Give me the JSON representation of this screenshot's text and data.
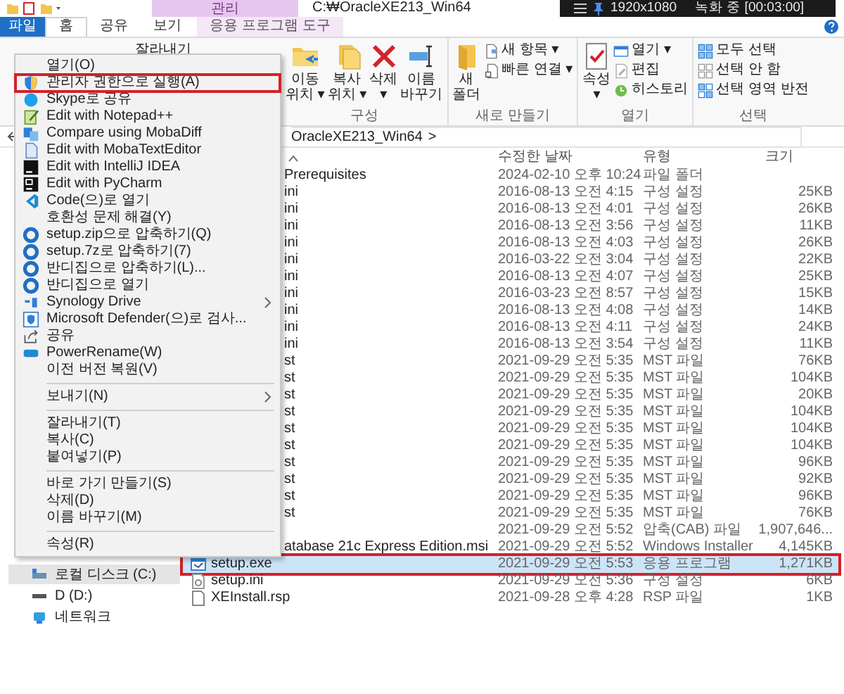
{
  "title_bar": {
    "context_label": "관리",
    "title": "C:₩OracleXE213_Win64"
  },
  "recorder": {
    "resolution": "1920x1080",
    "status": "녹화 중 [00:03:00]"
  },
  "tabs": [
    {
      "label": "파일",
      "kind": "file",
      "selected": false
    },
    {
      "label": "홈",
      "kind": "plain",
      "selected": true
    },
    {
      "label": "공유",
      "kind": "plain",
      "selected": false
    },
    {
      "label": "보기",
      "kind": "plain",
      "selected": false
    },
    {
      "label": "응용 프로그램 도구",
      "kind": "context",
      "selected": false
    }
  ],
  "ribbon": {
    "clipboard_fragment": "잘라내기",
    "groups": [
      {
        "label": "구성",
        "buttons": [
          {
            "kind": "move",
            "lines": [
              "이동",
              "위치 ▾"
            ]
          },
          {
            "kind": "copy",
            "lines": [
              "복사",
              "위치 ▾"
            ]
          },
          {
            "kind": "delete",
            "lines": [
              "삭제",
              "▾"
            ]
          },
          {
            "kind": "rename",
            "lines": [
              "이름",
              "바꾸기"
            ]
          }
        ]
      },
      {
        "label": "새로 만들기",
        "buttons": [
          {
            "kind": "new-folder",
            "lines": [
              "새",
              "폴더"
            ]
          },
          {
            "kind": "new-item",
            "lines": [
              "새 항목 ▾"
            ]
          },
          {
            "kind": "quick-link",
            "lines": [
              "빠른 연결 ▾"
            ]
          }
        ]
      },
      {
        "label": "열기",
        "buttons": [
          {
            "kind": "properties",
            "lines": [
              "속성",
              "▾"
            ]
          },
          {
            "kind": "open",
            "lines": [
              "열기 ▾"
            ]
          },
          {
            "kind": "edit",
            "lines": [
              "편집"
            ]
          },
          {
            "kind": "history",
            "lines": [
              "히스토리"
            ]
          }
        ]
      },
      {
        "label": "선택",
        "buttons": [
          {
            "kind": "select-all",
            "lines": [
              "모두 선택"
            ]
          },
          {
            "kind": "select-none",
            "lines": [
              "선택 안 함"
            ]
          },
          {
            "kind": "invert",
            "lines": [
              "선택 영역 반전"
            ]
          }
        ]
      }
    ]
  },
  "address": {
    "path": "OracleXE213_Win64",
    "separator": ">"
  },
  "nav": [
    {
      "label": "로컬 디스크 (C:)",
      "kind": "drive",
      "selected": true
    },
    {
      "label": "D (D:)",
      "kind": "disk",
      "selected": false
    },
    {
      "label": "네트워크",
      "kind": "network",
      "selected": false
    }
  ],
  "columns": [
    "수정한 날짜",
    "유형",
    "크기"
  ],
  "rows": [
    {
      "kind": "fragment",
      "name": "Prerequisites",
      "date": "2024-02-10 오후 10:24",
      "type": "파일 폴더",
      "selected": false,
      "annotated": false
    },
    {
      "kind": "fragment",
      "name": "ini",
      "date": "2016-08-13 오전 4:15",
      "type": "구성 설정",
      "size": "25KB",
      "selected": false,
      "annotated": false
    },
    {
      "kind": "fragment",
      "name": "ini",
      "date": "2016-08-13 오전 4:01",
      "type": "구성 설정",
      "size": "26KB",
      "selected": false,
      "annotated": false
    },
    {
      "kind": "fragment",
      "name": "ini",
      "date": "2016-08-13 오전 3:56",
      "type": "구성 설정",
      "size": "11KB",
      "selected": false,
      "annotated": false
    },
    {
      "kind": "fragment",
      "name": "ini",
      "date": "2016-08-13 오전 4:03",
      "type": "구성 설정",
      "size": "26KB",
      "selected": false,
      "annotated": false
    },
    {
      "kind": "fragment",
      "name": "ini",
      "date": "2016-03-22 오전 3:04",
      "type": "구성 설정",
      "size": "22KB",
      "selected": false,
      "annotated": false
    },
    {
      "kind": "fragment",
      "name": "ini",
      "date": "2016-08-13 오전 4:07",
      "type": "구성 설정",
      "size": "25KB",
      "selected": false,
      "annotated": false
    },
    {
      "kind": "fragment",
      "name": "ini",
      "date": "2016-03-23 오전 8:57",
      "type": "구성 설정",
      "size": "15KB",
      "selected": false,
      "annotated": false
    },
    {
      "kind": "fragment",
      "name": "ini",
      "date": "2016-08-13 오전 4:08",
      "type": "구성 설정",
      "size": "14KB",
      "selected": false,
      "annotated": false
    },
    {
      "kind": "fragment",
      "name": "ini",
      "date": "2016-08-13 오전 4:11",
      "type": "구성 설정",
      "size": "24KB",
      "selected": false,
      "annotated": false
    },
    {
      "kind": "fragment",
      "name": "ini",
      "date": "2016-08-13 오전 3:54",
      "type": "구성 설정",
      "size": "11KB",
      "selected": false,
      "annotated": false
    },
    {
      "kind": "fragment",
      "name": "st",
      "date": "2021-09-29 오전 5:35",
      "type": "MST 파일",
      "size": "76KB",
      "selected": false,
      "annotated": false
    },
    {
      "kind": "fragment",
      "name": "st",
      "date": "2021-09-29 오전 5:35",
      "type": "MST 파일",
      "size": "104KB",
      "selected": false,
      "annotated": false
    },
    {
      "kind": "fragment",
      "name": "st",
      "date": "2021-09-29 오전 5:35",
      "type": "MST 파일",
      "size": "20KB",
      "selected": false,
      "annotated": false
    },
    {
      "kind": "fragment",
      "name": "st",
      "date": "2021-09-29 오전 5:35",
      "type": "MST 파일",
      "size": "104KB",
      "selected": false,
      "annotated": false
    },
    {
      "kind": "fragment",
      "name": "st",
      "date": "2021-09-29 오전 5:35",
      "type": "MST 파일",
      "size": "104KB",
      "selected": false,
      "annotated": false
    },
    {
      "kind": "fragment",
      "name": "st",
      "date": "2021-09-29 오전 5:35",
      "type": "MST 파일",
      "size": "104KB",
      "selected": false,
      "annotated": false
    },
    {
      "kind": "fragment",
      "name": "st",
      "date": "2021-09-29 오전 5:35",
      "type": "MST 파일",
      "size": "96KB",
      "selected": false,
      "annotated": false
    },
    {
      "kind": "fragment",
      "name": "st",
      "date": "2021-09-29 오전 5:35",
      "type": "MST 파일",
      "size": "92KB",
      "selected": false,
      "annotated": false
    },
    {
      "kind": "fragment",
      "name": "st",
      "date": "2021-09-29 오전 5:35",
      "type": "MST 파일",
      "size": "96KB",
      "selected": false,
      "annotated": false
    },
    {
      "kind": "fragment",
      "name": "st",
      "date": "2021-09-29 오전 5:35",
      "type": "MST 파일",
      "size": "76KB",
      "selected": false,
      "annotated": false
    },
    {
      "kind": "fragment",
      "date": "2021-09-29 오전 5:52",
      "type": "압축(CAB) 파일",
      "size": "1,907,646...",
      "selected": false,
      "annotated": false
    },
    {
      "kind": "fragment",
      "name": "atabase 21c Express Edition.msi",
      "date": "2021-09-29 오전 5:52",
      "type": "Windows Installer",
      "size": "4,145KB",
      "selected": false,
      "annotated": false
    },
    {
      "kind": "exe",
      "name": "setup.exe",
      "date": "2021-09-29 오전 5:53",
      "type": "응용 프로그램",
      "size": "1,271KB",
      "selected": true,
      "annotated": true
    },
    {
      "kind": "ini",
      "name": "setup.ini",
      "date": "2021-09-29 오전 5:36",
      "type": "구성 설정",
      "size": "6KB",
      "selected": false,
      "annotated": false
    },
    {
      "kind": "rsp",
      "name": "XEInstall.rsp",
      "date": "2021-09-28 오후 4:28",
      "type": "RSP 파일",
      "size": "1KB",
      "selected": false,
      "annotated": false
    }
  ],
  "context_menu": [
    {
      "kind": "plain",
      "label": "열기(O)",
      "submenu": false,
      "annotated": false
    },
    {
      "kind": "shield",
      "label": "관리자 권한으로 실행(A)",
      "submenu": false,
      "annotated": true
    },
    {
      "kind": "skype",
      "label": "Skype로 공유",
      "submenu": false,
      "annotated": false
    },
    {
      "kind": "notepad",
      "label": "Edit with Notepad++",
      "submenu": false,
      "annotated": false
    },
    {
      "kind": "diff",
      "label": "Compare using MobaDiff",
      "submenu": false,
      "annotated": false
    },
    {
      "kind": "editor",
      "label": "Edit with MobaTextEditor",
      "submenu": false,
      "annotated": false
    },
    {
      "kind": "intellij",
      "label": "Edit with IntelliJ IDEA",
      "submenu": false,
      "annotated": false
    },
    {
      "kind": "pycharm",
      "label": "Edit with PyCharm",
      "submenu": false,
      "annotated": false
    },
    {
      "kind": "vscode",
      "label": "Code(으)로 열기",
      "submenu": false,
      "annotated": false
    },
    {
      "kind": "plain",
      "label": "호환성 문제 해결(Y)",
      "submenu": false,
      "annotated": false
    },
    {
      "kind": "bandizip",
      "label": "setup.zip으로 압축하기(Q)",
      "submenu": false,
      "annotated": false
    },
    {
      "kind": "bandizip",
      "label": "setup.7z로 압축하기(7)",
      "submenu": false,
      "annotated": false
    },
    {
      "kind": "bandizip",
      "label": "반디집으로 압축하기(L)...",
      "submenu": false,
      "annotated": false
    },
    {
      "kind": "bandizip",
      "label": "반디집으로 열기",
      "submenu": false,
      "annotated": false
    },
    {
      "kind": "synology",
      "label": "Synology Drive",
      "submenu": true,
      "annotated": false
    },
    {
      "kind": "defender",
      "label": "Microsoft Defender(으)로 검사...",
      "submenu": false,
      "annotated": false
    },
    {
      "kind": "share",
      "label": "공유",
      "submenu": false,
      "annotated": false
    },
    {
      "kind": "rename",
      "label": "PowerRename(W)",
      "submenu": false,
      "annotated": false
    },
    {
      "kind": "plain",
      "label": "이전 버전 복원(V)",
      "submenu": false,
      "annotated": false
    },
    {
      "kind": "separator"
    },
    {
      "kind": "plain",
      "label": "보내기(N)",
      "submenu": true,
      "annotated": false
    },
    {
      "kind": "separator"
    },
    {
      "kind": "plain",
      "label": "잘라내기(T)",
      "submenu": false,
      "annotated": false
    },
    {
      "kind": "plain",
      "label": "복사(C)",
      "submenu": false,
      "annotated": false
    },
    {
      "kind": "plain",
      "label": "붙여넣기(P)",
      "submenu": false,
      "annotated": false
    },
    {
      "kind": "separator"
    },
    {
      "kind": "plain",
      "label": "바로 가기 만들기(S)",
      "submenu": false,
      "annotated": false
    },
    {
      "kind": "plain",
      "label": "삭제(D)",
      "submenu": false,
      "annotated": false
    },
    {
      "kind": "plain",
      "label": "이름 바꾸기(M)",
      "submenu": false,
      "annotated": false
    },
    {
      "kind": "separator"
    },
    {
      "kind": "plain",
      "label": "속성(R)",
      "submenu": false,
      "annotated": false
    }
  ]
}
